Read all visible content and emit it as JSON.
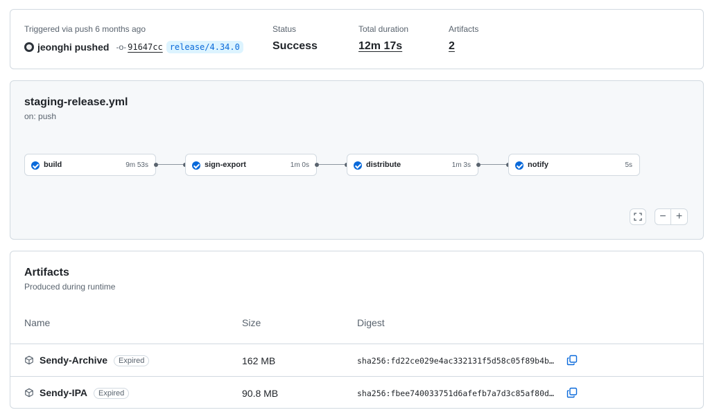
{
  "summary": {
    "trigger_label": "Triggered via push 6 months ago",
    "actor_text": "jeonghi pushed",
    "commit": "91647cc",
    "branch": "release/4.34.0",
    "status_label": "Status",
    "status_value": "Success",
    "duration_label": "Total duration",
    "duration_value": "12m 17s",
    "artifacts_label": "Artifacts",
    "artifacts_value": "2"
  },
  "workflow": {
    "file": "staging-release.yml",
    "event": "on: push",
    "jobs": [
      {
        "name": "build",
        "duration": "9m 53s",
        "status": "success"
      },
      {
        "name": "sign-export",
        "duration": "1m 0s",
        "status": "success"
      },
      {
        "name": "distribute",
        "duration": "1m 3s",
        "status": "success"
      },
      {
        "name": "notify",
        "duration": "5s",
        "status": "success"
      }
    ],
    "controls": {
      "fullscreen_icon": "fullscreen-icon",
      "zoom_out": "−",
      "zoom_in": "+"
    }
  },
  "artifacts": {
    "title": "Artifacts",
    "subtitle": "Produced during runtime",
    "columns": [
      "Name",
      "Size",
      "Digest"
    ],
    "rows": [
      {
        "name": "Sendy-Archive",
        "badge": "Expired",
        "size": "162 MB",
        "digest": "sha256:fd22ce029e4ac332131f5d58c05f89b4b…"
      },
      {
        "name": "Sendy-IPA",
        "badge": "Expired",
        "size": "90.8 MB",
        "digest": "sha256:fbee740033751d6afefb7a7d3c85af80d…"
      }
    ]
  },
  "colors": {
    "accent": "#0969da",
    "border": "#d1d9e0",
    "muted": "#59636e"
  }
}
